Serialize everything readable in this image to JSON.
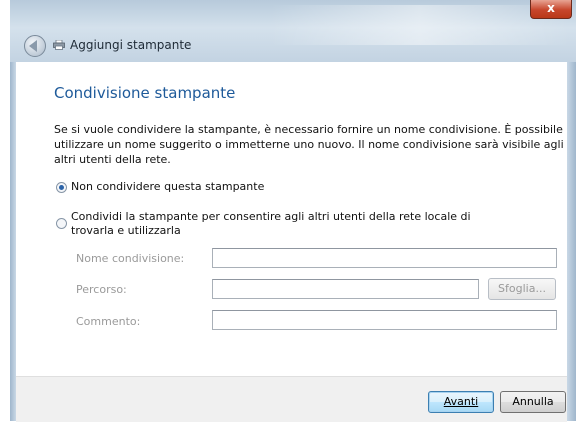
{
  "window": {
    "title": "Aggiungi stampante",
    "close_symbol": "x"
  },
  "page": {
    "heading": "Condivisione stampante",
    "description": "Se si vuole condividere la stampante, è necessario fornire un nome condivisione. È possibile utilizzare un nome suggerito o immetterne uno nuovo. Il nome condivisione sarà visibile agli altri utenti della rete."
  },
  "options": [
    {
      "label": "Non condividere questa stampante",
      "selected": true
    },
    {
      "label": "Condividi la stampante per consentire agli altri utenti della rete locale di trovarla e utilizzarla",
      "selected": false
    }
  ],
  "fields": {
    "share_name": {
      "label": "Nome condivisione:",
      "value": ""
    },
    "location": {
      "label": "Percorso:",
      "value": ""
    },
    "comment": {
      "label": "Commento:",
      "value": ""
    }
  },
  "buttons": {
    "browse": "Sfoglia...",
    "next": "Avanti",
    "cancel": "Annulla"
  },
  "colors": {
    "heading": "#1e5a9a",
    "close_button": "#c7462c",
    "disabled_text": "#9a9a9a"
  },
  "icons": [
    "back-arrow-icon",
    "printer-icon",
    "close-icon"
  ]
}
